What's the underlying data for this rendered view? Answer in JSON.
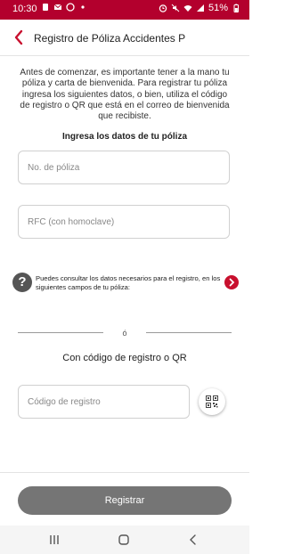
{
  "status_bar": {
    "time": "10:30",
    "battery": "51%",
    "left_icons": [
      "sim-icon",
      "mail-icon",
      "whatsapp-icon",
      "dot-icon"
    ],
    "right_icons": [
      "alarm-icon",
      "mute-icon",
      "wifi-icon",
      "signal-icon",
      "battery-icon"
    ]
  },
  "header": {
    "title": "Registro de Póliza Accidentes P",
    "back_icon": "chevron-left-icon"
  },
  "intro": {
    "text": "Antes de comenzar, es importante tener a la mano tu póliza y carta de bienvenida. Para registrar tu póliza ingresa los siguientes datos, o bien, utiliza el código de registro o QR que está en el correo de bienvenida que recibiste."
  },
  "form": {
    "section_title": "Ingresa los datos de tu póliza",
    "policy_placeholder": "No. de póliza",
    "rfc_placeholder": "RFC (con homoclave)",
    "policy_value": "",
    "rfc_value": ""
  },
  "info": {
    "help_icon": "question-mark-icon",
    "text": "Puedes consultar los datos necesarios para el registro, en los siguientes campos de tu póliza:",
    "arrow_icon": "chevron-right-icon"
  },
  "divider": {
    "text": "ó"
  },
  "qr_section": {
    "title": "Con código de registro o QR",
    "code_placeholder": "Código de registro",
    "code_value": "",
    "qr_icon": "qr-code-icon"
  },
  "footer": {
    "register_label": "Registrar"
  },
  "nav": {
    "items": [
      "recents-icon",
      "home-icon",
      "back-icon"
    ]
  },
  "colors": {
    "brand_red": "#b3002d",
    "accent_red": "#c8102e",
    "button_gray": "#757575"
  }
}
